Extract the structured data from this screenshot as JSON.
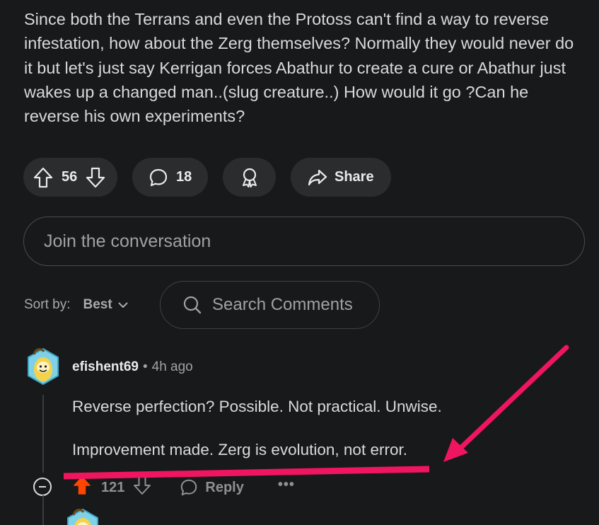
{
  "post": {
    "body": "Since both the Terrans and even the Protoss can't find a way to reverse infestation, how about the Zerg themselves? Normally they would never do it but let's just say Kerrigan forces Abathur to create a cure or Abathur just wakes up a changed man..(slug creature..) How would it go ?Can he reverse his own experiments?"
  },
  "actions": {
    "vote_count": "56",
    "comment_count": "18",
    "share_label": "Share"
  },
  "join": {
    "placeholder": "Join the conversation"
  },
  "sort": {
    "label": "Sort by:",
    "value": "Best"
  },
  "search": {
    "placeholder": "Search Comments"
  },
  "comment": {
    "author": "efishent69",
    "separator": "•",
    "time": "4h ago",
    "paragraphs": [
      "Reverse perfection? Possible. Not practical. Unwise.",
      "Improvement made. Zerg is evolution, not error."
    ],
    "score": "121",
    "reply_label": "Reply",
    "more_label": "•••",
    "upvoted": true
  },
  "colors": {
    "background": "#18191a",
    "pill": "#2a2c2e",
    "upvote_active": "#ff4500",
    "annotation": "#f0155f"
  },
  "icons": {
    "upvote": "arrow-up-icon",
    "downvote": "arrow-down-icon",
    "comment": "speech-bubble-icon",
    "award": "award-ribbon-icon",
    "share": "share-arrow-icon",
    "sort": "chevron-down-icon",
    "search": "search-icon",
    "collapse": "minus-circle-icon",
    "more": "ellipsis-icon"
  }
}
